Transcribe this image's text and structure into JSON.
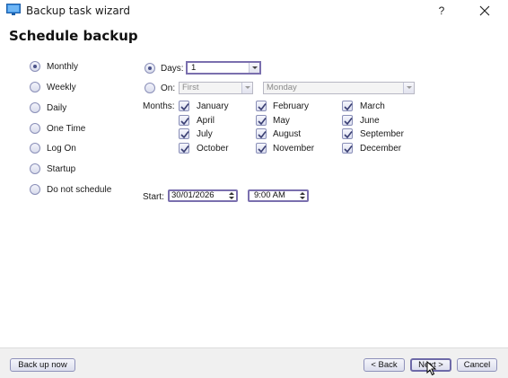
{
  "window": {
    "title": "Backup task wizard",
    "help_label": "?"
  },
  "page": {
    "title": "Schedule backup"
  },
  "schedule_types": [
    {
      "label": "Monthly",
      "checked": true
    },
    {
      "label": "Weekly",
      "checked": false
    },
    {
      "label": "Daily",
      "checked": false
    },
    {
      "label": "One Time",
      "checked": false
    },
    {
      "label": "Log On",
      "checked": false
    },
    {
      "label": "Startup",
      "checked": false
    },
    {
      "label": "Do not schedule",
      "checked": false
    }
  ],
  "monthly": {
    "days_label": "Days:",
    "days_value": "1",
    "on_label": "On:",
    "on_week_value": "First",
    "on_day_value": "Monday",
    "months_label": "Months:",
    "months": [
      {
        "label": "January",
        "checked": true
      },
      {
        "label": "February",
        "checked": true
      },
      {
        "label": "March",
        "checked": true
      },
      {
        "label": "April",
        "checked": true
      },
      {
        "label": "May",
        "checked": true
      },
      {
        "label": "June",
        "checked": true
      },
      {
        "label": "July",
        "checked": true
      },
      {
        "label": "August",
        "checked": true
      },
      {
        "label": "September",
        "checked": true
      },
      {
        "label": "October",
        "checked": true
      },
      {
        "label": "November",
        "checked": true
      },
      {
        "label": "December",
        "checked": true
      }
    ],
    "start_label": "Start:",
    "start_date": "30/01/2026",
    "start_time": "9:00 AM"
  },
  "footer": {
    "backup_now_label": "Back up now",
    "back_label": "< Back",
    "next_label": "Next >",
    "cancel_label": "Cancel"
  },
  "colors": {
    "accent": "#6e6aa8",
    "footer_bg": "#f0f0f0"
  }
}
